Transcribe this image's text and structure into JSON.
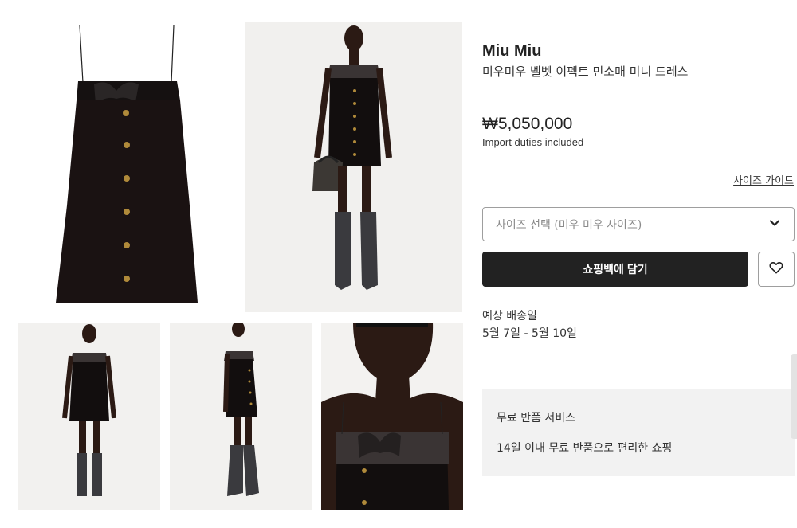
{
  "gallery": {
    "images": [
      {
        "name": "dress-flat-front"
      },
      {
        "name": "model-front-with-bag"
      },
      {
        "name": "model-back"
      },
      {
        "name": "model-side"
      },
      {
        "name": "model-closeup"
      }
    ]
  },
  "product": {
    "brand": "Miu Miu",
    "name": "미우미우 벨벳 이펙트 민소매 미니 드레스",
    "price": "₩5,050,000",
    "duties_note": "Import duties included"
  },
  "size": {
    "guide_link": "사이즈 가이드",
    "select_placeholder": "사이즈 선택 (미우 미우 사이즈)"
  },
  "actions": {
    "add_to_bag": "쇼핑백에 담기"
  },
  "shipping": {
    "label": "예상 배송일",
    "date_range": "5월 7일 - 5월 10일"
  },
  "returns": {
    "title": "무료 반품 서비스",
    "description": "14일 이내 무료 반품으로 편리한 쇼핑"
  },
  "colors": {
    "button_dark": "#222222",
    "panel_bg": "#f2f2f2",
    "border": "#9e9e9e"
  }
}
